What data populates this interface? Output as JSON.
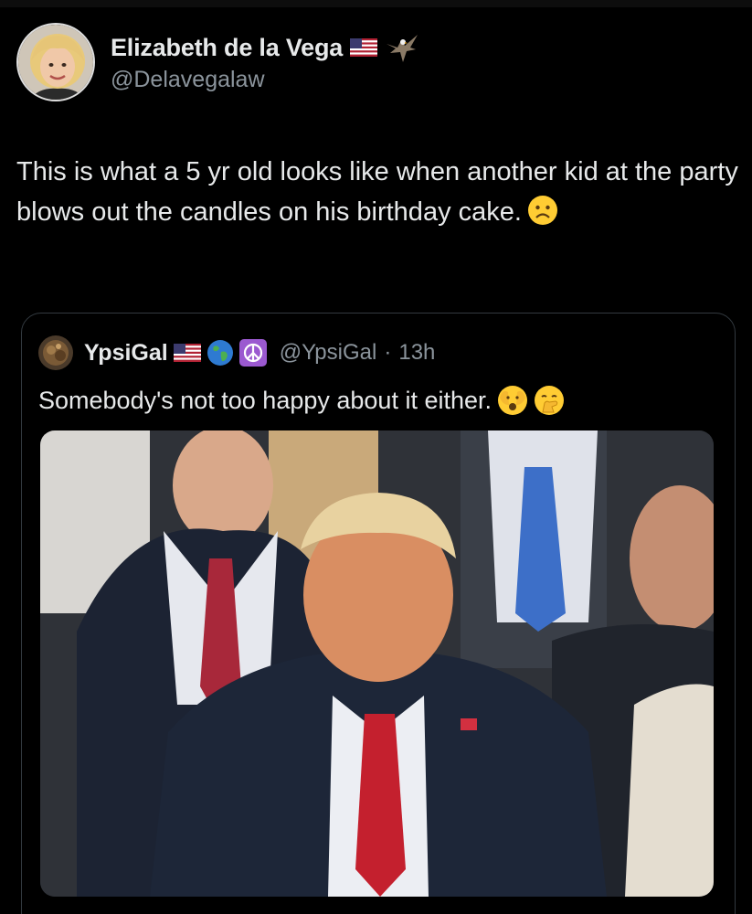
{
  "author": {
    "display_name": "Elizabeth de la Vega",
    "handle": "@Delavegalaw",
    "badges": [
      "us-flag-icon",
      "eagle-icon"
    ]
  },
  "tweet": {
    "text": "This is what a 5 yr old looks like when another kid at the party blows out the candles on his birthday cake.",
    "emoji": "frowning-face-icon"
  },
  "quoted_tweet": {
    "display_name": "YpsiGal",
    "badges": [
      "us-flag-icon",
      "globe-icon",
      "peace-symbol-icon"
    ],
    "handle": "@YpsiGal",
    "separator": "·",
    "time": "13h",
    "text": "Somebody's not too happy about it either.",
    "emojis": [
      "face-peeking-icon",
      "hand-over-mouth-icon"
    ],
    "media": "photo of seated man in dark suit and red tie looking displeased"
  },
  "colors": {
    "background": "#000000",
    "text_primary": "#e7e9ea",
    "text_secondary": "#8b949c",
    "border": "#333a40"
  }
}
